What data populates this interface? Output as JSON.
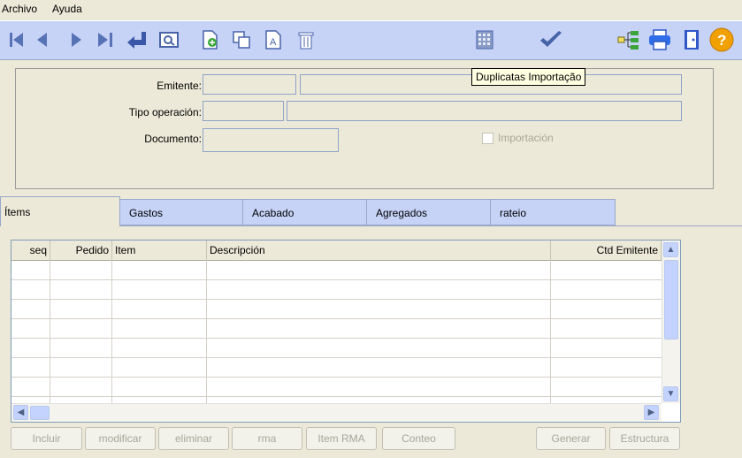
{
  "menu": {
    "items": [
      "Archivo",
      "Ayuda"
    ]
  },
  "toolbar": {
    "icons": [
      "first-record-icon",
      "previous-record-icon",
      "next-record-icon",
      "last-record-icon",
      "return-icon",
      "preview-icon",
      "new-document-icon",
      "copy-icon",
      "text-edit-icon",
      "trash-icon",
      "calendar-grid-icon",
      "confirm-check-icon",
      "tree-structure-icon",
      "printer-icon",
      "exit-door-icon",
      "help-icon"
    ],
    "tooltip": "Duplicatas Importação"
  },
  "header": {
    "emitente_label": "Emitente:",
    "tipo_operacion_label": "Tipo operación:",
    "documento_label": "Documento:",
    "importacion_label": "Importación",
    "emitente_code": "",
    "emitente_name": "",
    "tipo_code": "",
    "tipo_desc": "",
    "documento": ""
  },
  "tabs": [
    "Ítems",
    "Gastos",
    "Acabado",
    "Agregados",
    "rateio"
  ],
  "grid": {
    "columns": [
      "seq",
      "Pedido",
      "Item",
      "Descripción",
      "Ctd Emitente"
    ],
    "rows": []
  },
  "buttons": {
    "incluir": "Incluir",
    "modificar": "modificar",
    "eliminar": "eliminar",
    "rma": "rma",
    "item_rma": "Item RMA",
    "conteo": "Conteo",
    "generar": "Generar",
    "estructura": "Estructura"
  }
}
